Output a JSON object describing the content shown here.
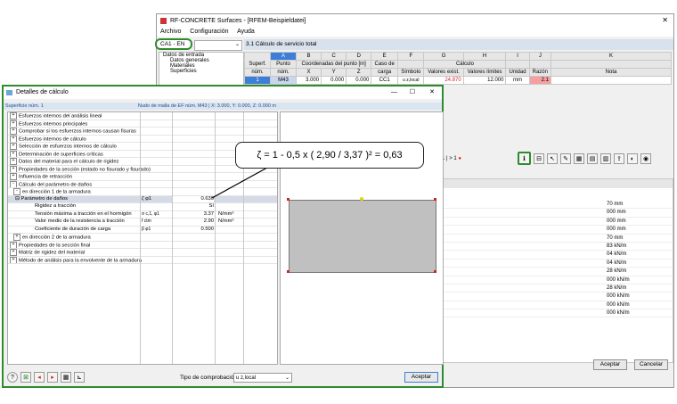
{
  "main_window": {
    "title": "RF-CONCRETE Surfaces - [RFEM-Beispieldatei]",
    "menu": [
      "Archivo",
      "Configuración",
      "Ayuda"
    ],
    "case_select": "CA1 - EN",
    "tree": [
      "Datos de entrada",
      "Datos generales",
      "Materiales",
      "Superficies"
    ],
    "table_title": "3.1 Cálculo de servicio total",
    "col_letters": [
      "A",
      "B",
      "C",
      "D",
      "E",
      "F",
      "G",
      "H",
      "I",
      "J",
      "K"
    ],
    "header_top": {
      "superf": "Superf.",
      "punto": "Punto",
      "coord": "Coordenadas del punto [m]",
      "caso": "Caso de",
      "calculo": "Cálculo"
    },
    "header_bottom": {
      "num": "núm.",
      "punto_num": "núm.",
      "x": "X",
      "y": "Y",
      "z": "Z",
      "carga": "carga",
      "simbolo": "Símbolo",
      "exist": "Valores exist.",
      "limites": "Valores límites",
      "unidad": "Unidad",
      "razon": "Razón",
      "nota": "Nota"
    },
    "row": {
      "superf": "1",
      "punto": "M43",
      "x": "3.000",
      "y": "0.000",
      "z": "0.000",
      "carga": "CC1",
      "simbolo": "u z,local",
      "exist": "24.870",
      "limite": "12.000",
      "unidad": "mm",
      "razon": "2.1"
    },
    "toolbar_left": "1 | > 1",
    "lower_rows": [
      "70 mm",
      "000 mm",
      "000 mm",
      "000 mm",
      "70 mm",
      "83 kN/m",
      "04 kN/m",
      "04 kN/m",
      "28 kN/m",
      "000 kN/m",
      "28 kN/m",
      "000 kN/m",
      "000 kN/m",
      "000 kN/m"
    ],
    "accept_button": "Aceptar",
    "cancel_button": "Cancelar"
  },
  "dialog": {
    "title": "Detalles de cálculo",
    "left_header": "Superficie núm. 1",
    "right_header": "Nudo de malla de EF núm. M43 | X: 3.000, Y: 0.000, Z: 0.000 m",
    "rows": [
      {
        "text": "Esfuerzos internos del análisis lineal",
        "exp": "+"
      },
      {
        "text": "Esfuerzos internos principales",
        "exp": "+"
      },
      {
        "text": "Comprobar si los esfuerzos internos causan fisuras",
        "exp": "+"
      },
      {
        "text": "Esfuerzos internos de cálculo",
        "exp": "+"
      },
      {
        "text": "Selección de esfuerzos internos de cálculo",
        "exp": "+"
      },
      {
        "text": "Determinación de superficies críticas",
        "exp": "+"
      },
      {
        "text": "Datos del material para el cálculo de rigidez",
        "exp": "+"
      },
      {
        "text": "Propiedades de la sección (estado no fisurado y fisurado)",
        "exp": "+"
      },
      {
        "text": "Influencia de retracción",
        "exp": "+"
      },
      {
        "text": "Cálculo del parámetro de daños",
        "exp": "-"
      },
      {
        "text": "en dirección 1 de la armadura",
        "exp": "-"
      }
    ],
    "param_row": {
      "label": "Parámetro de daños",
      "symbol": "ζ φ1",
      "value": "0.630"
    },
    "sub_rows": [
      {
        "label": "Rigidez a tracción",
        "symbol": "",
        "value": "Sí",
        "unit": ""
      },
      {
        "label": "Tensión máxima a tracción en el hormigón",
        "symbol": "σ c,1, φ1",
        "value": "3.37",
        "unit": "N/mm²"
      },
      {
        "label": "Valor medio de la resistencia a tracción",
        "symbol": "f ctm",
        "value": "2.90",
        "unit": "N/mm²"
      },
      {
        "label": "Coeficiente de duración de carga",
        "symbol": "β φ1",
        "value": "0.500",
        "unit": ""
      }
    ],
    "after_rows": [
      {
        "text": "en dirección 2 de la armadura",
        "exp": "+"
      },
      {
        "text": "Propiedades de la sección final",
        "exp": "+"
      },
      {
        "text": "Matriz de rigidez del material",
        "exp": "+"
      },
      {
        "text": "Método de análisis para la envolvente de la armadura",
        "exp": "+"
      }
    ],
    "tipo_label": "Tipo de comprobación:",
    "tipo_value": "u z,local",
    "accept_button": "Aceptar"
  },
  "callout": {
    "formula": "ζ = 1 - 0,5 x ( 2,90 / 3,37 )² = 0,63"
  }
}
